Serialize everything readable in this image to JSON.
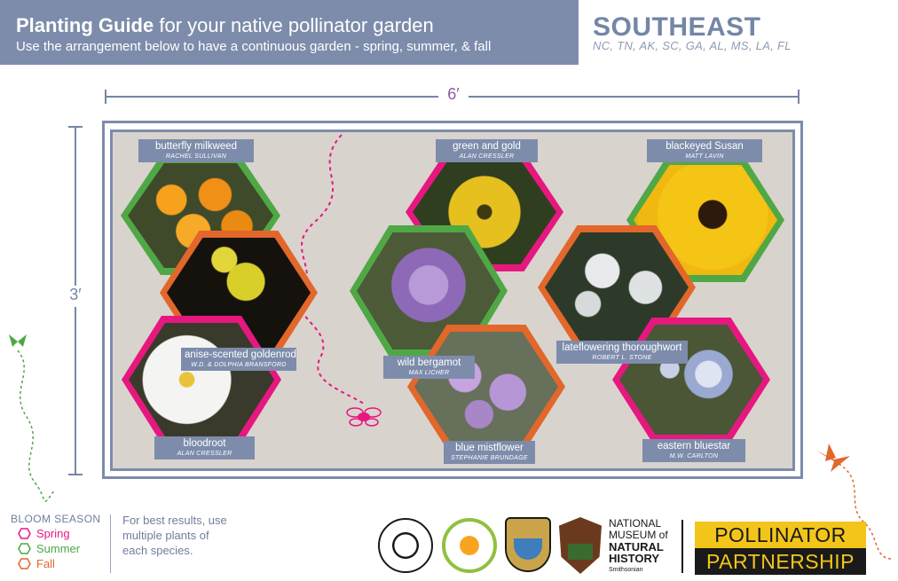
{
  "header": {
    "title_bold": "Planting Guide",
    "title_rest": " for your native pollinator garden",
    "subtitle": "Use the arrangement below to have a continuous garden - spring, summer, & fall",
    "region": "SOUTHEAST",
    "states": "NC, TN, AK, SC, GA, AL, MS, LA, FL"
  },
  "dimensions": {
    "width": "6′",
    "height": "3′"
  },
  "plants": [
    {
      "name": "butterfly milkweed",
      "credit": "RACHEL SULLIVAN",
      "season": "Summer"
    },
    {
      "name": "green and gold",
      "credit": "ALAN CRESSLER",
      "season": "Spring"
    },
    {
      "name": "blackeyed Susan",
      "credit": "MATT LAVIN",
      "season": "Summer"
    },
    {
      "name": "anise-scented goldenrod",
      "credit": "W.D. & DOLPHIA BRANSFORD",
      "season": "Fall"
    },
    {
      "name": "wild bergamot",
      "credit": "MAX LICHER",
      "season": "Summer"
    },
    {
      "name": "lateflowering thoroughwort",
      "credit": "ROBERT L. STONE",
      "season": "Fall"
    },
    {
      "name": "bloodroot",
      "credit": "ALAN CRESSLER",
      "season": "Spring"
    },
    {
      "name": "blue mistflower",
      "credit": "STEPHANIE BRUNDAGE",
      "season": "Fall"
    },
    {
      "name": "eastern bluestar",
      "credit": "M.W. CARLTON",
      "season": "Spring"
    }
  ],
  "legend": {
    "title": "BLOOM SEASON",
    "items": [
      {
        "label": "Spring",
        "color": "#e6187f"
      },
      {
        "label": "Summer",
        "color": "#4fa845"
      },
      {
        "label": "Fall",
        "color": "#e2672a"
      }
    ]
  },
  "tip": "For best results, use multiple plants of each species.",
  "logos": {
    "nmnh_line1": "NATIONAL",
    "nmnh_line2": "MUSEUM of",
    "nmnh_line3": "NATURAL",
    "nmnh_line4": "HISTORY",
    "nmnh_line5": "Smithsonian",
    "pp_line1": "POLLINATOR",
    "pp_line2": "PARTNERSHIP"
  },
  "colors": {
    "spring": "#e6187f",
    "summer": "#4fa845",
    "fall": "#e2672a",
    "label_bg": "#7d8cab"
  }
}
